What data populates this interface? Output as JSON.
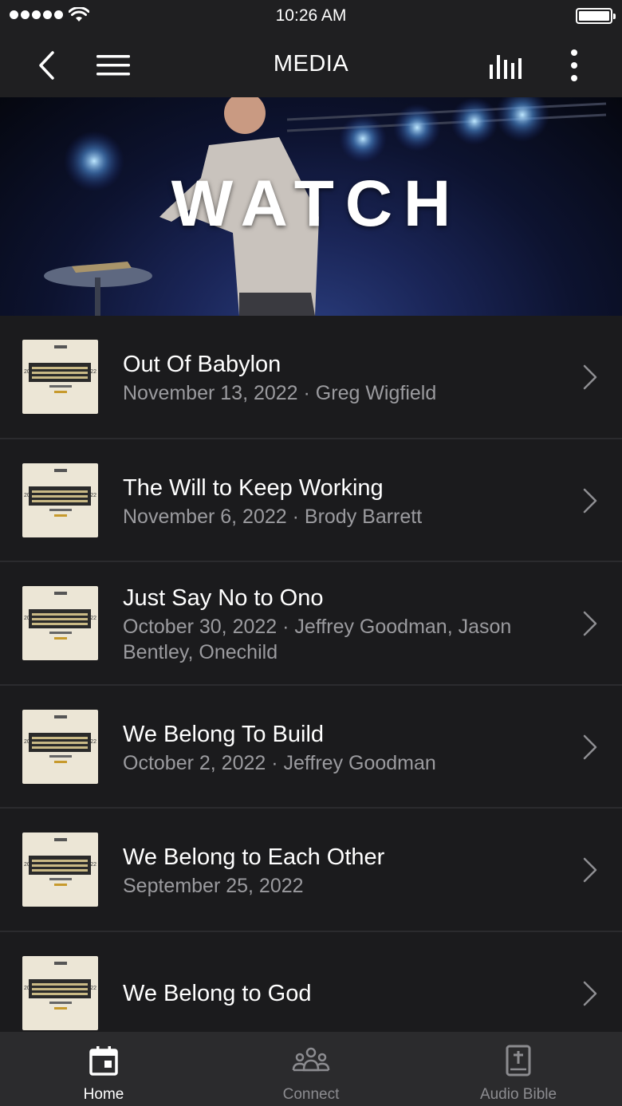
{
  "status_bar": {
    "time": "10:26 AM"
  },
  "nav": {
    "title": "MEDIA",
    "icons": [
      "back-icon",
      "menu-icon",
      "audio-bars-icon",
      "more-vertical-icon"
    ]
  },
  "hero": {
    "title": "WATCH"
  },
  "sermons": [
    {
      "title": "Out Of Babylon",
      "meta": "November 13, 2022 · Greg Wigfield"
    },
    {
      "title": "The Will to Keep Working",
      "meta": "November 6, 2022 · Brody Barrett"
    },
    {
      "title": "Just Say No to Ono",
      "meta": "October 30, 2022 · Jeffrey Goodman, Jason Bentley, Onechild"
    },
    {
      "title": "We Belong To Build",
      "meta": "October 2, 2022 · Jeffrey Goodman"
    },
    {
      "title": "We Belong to Each Other",
      "meta": "September 25, 2022"
    },
    {
      "title": "We Belong to God",
      "meta": ""
    }
  ],
  "tabs": [
    {
      "label": "Home",
      "icon": "calendar-icon",
      "active": true
    },
    {
      "label": "Connect",
      "icon": "group-icon",
      "active": false
    },
    {
      "label": "Audio Bible",
      "icon": "bible-icon",
      "active": false
    }
  ],
  "colors": {
    "background": "#1b1b1d",
    "bar": "#1f1f21",
    "tabbar": "#2b2b2d",
    "secondary_text": "#9b9b9f",
    "divider": "#2b2b2e"
  }
}
